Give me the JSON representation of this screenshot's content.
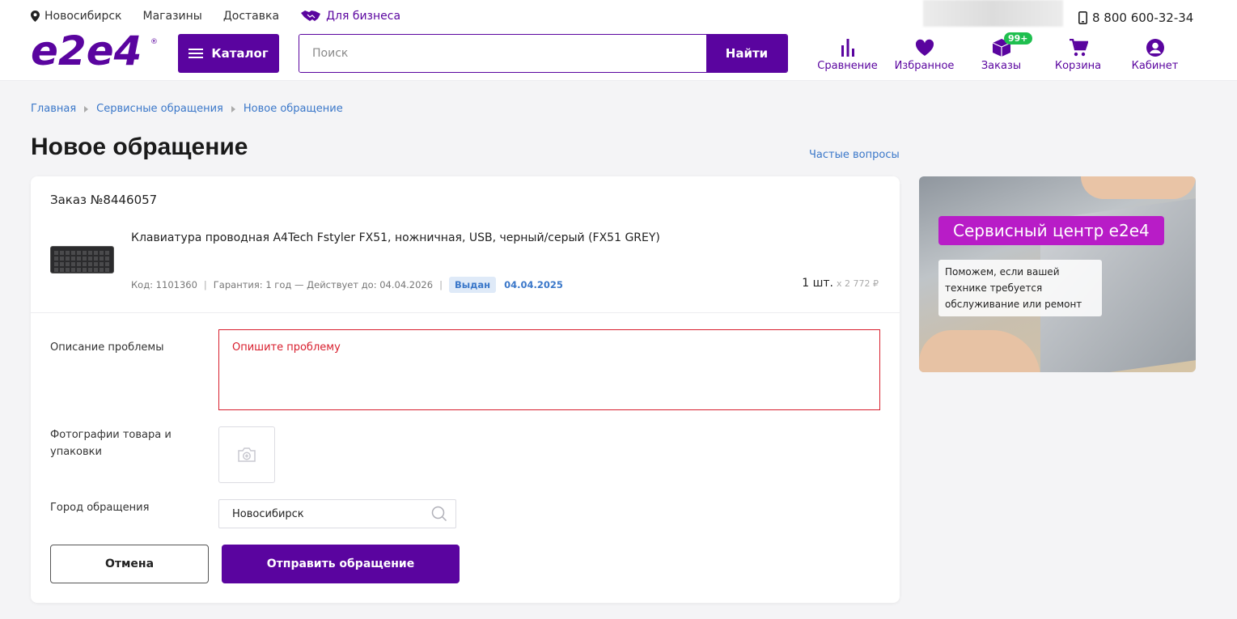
{
  "topbar": {
    "city": "Новосибирск",
    "stores": "Магазины",
    "delivery": "Доставка",
    "business": "Для бизнеса",
    "phone": "8 800 600-32-34"
  },
  "logo": {
    "text": "e2e4"
  },
  "catalog": {
    "label": "Каталог"
  },
  "search": {
    "placeholder": "Поиск",
    "button": "Найти"
  },
  "nav": {
    "compare": "Сравнение",
    "favorites": "Избранное",
    "orders": "Заказы",
    "orders_badge": "99+",
    "cart": "Корзина",
    "account": "Кабинет"
  },
  "breadcrumbs": [
    "Главная",
    "Сервисные обращения",
    "Новое обращение"
  ],
  "page": {
    "title": "Новое обращение",
    "faq": "Частые вопросы"
  },
  "order": {
    "title": "Заказ №8446057",
    "product": "Клавиатура проводная A4Tech Fstyler FX51, ножничная, USB, черный/серый (FX51 GREY)",
    "code": "Код: 1101360",
    "warranty": "Гарантия: 1 год — Действует до: 04.04.2026",
    "status": "Выдан",
    "status_date": "04.04.2025",
    "qty": "1 шт.",
    "price": "x 2 772 ₽"
  },
  "form": {
    "problem_label": "Описание проблемы",
    "problem_placeholder": "Опишите проблему",
    "photos_label": "Фотографии товара и упаковки",
    "city_label": "Город обращения",
    "city_value": "Новосибирск",
    "cancel": "Отмена",
    "submit": "Отправить обращение"
  },
  "banner": {
    "title": "Сервисный центр e2e4",
    "subtitle": "Поможем, если вашей технике требуется обслуживание или ремонт"
  },
  "colors": {
    "brand": "#5a049f",
    "link": "#3a77c9",
    "error": "#d81e2d",
    "badge": "#1fbf4f",
    "banner_accent": "#b81cc7"
  }
}
